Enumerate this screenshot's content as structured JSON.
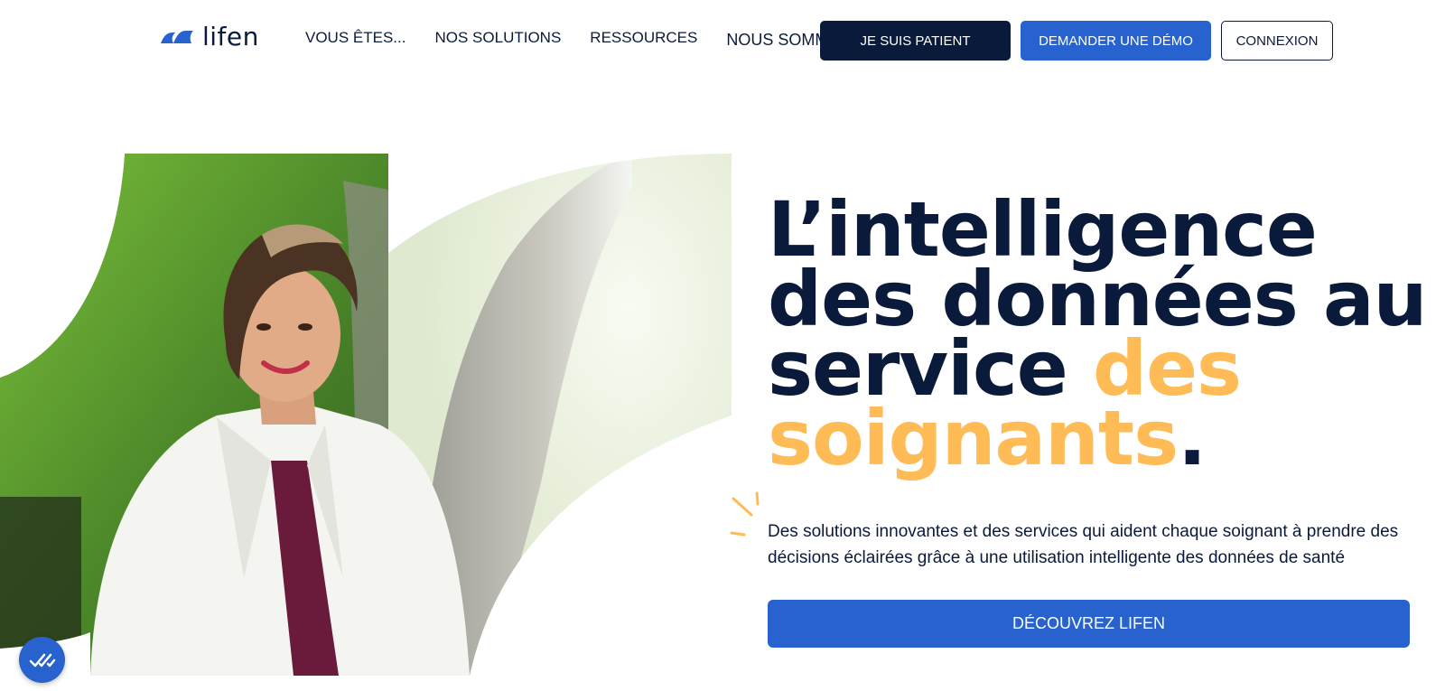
{
  "brand": {
    "name": "lifen",
    "color": "#2762cf"
  },
  "nav": {
    "items": [
      "VOUS ÊTES...",
      "NOS SOLUTIONS",
      "RESSOURCES",
      "NOUS SOMMES"
    ]
  },
  "header_buttons": {
    "patient": "JE SUIS PATIENT",
    "demo": "DEMANDER UNE DÉMO",
    "login": "CONNEXION"
  },
  "hero": {
    "headline_part1": "L’intelligence des données au service ",
    "headline_accent": "des soignants",
    "headline_end": ".",
    "subtitle": "Des solutions innovantes et des services qui aident chaque soignant à prendre des décisions éclairées grâce à une utilisation intelligente des données de santé",
    "cta": "DÉCOUVREZ LIFEN",
    "image_icon": "doctor-photo"
  },
  "colors": {
    "navy": "#0a1a3a",
    "accent": "#ffbb55",
    "blue": "#2762cf"
  },
  "fab_icon": "double-check-icon"
}
